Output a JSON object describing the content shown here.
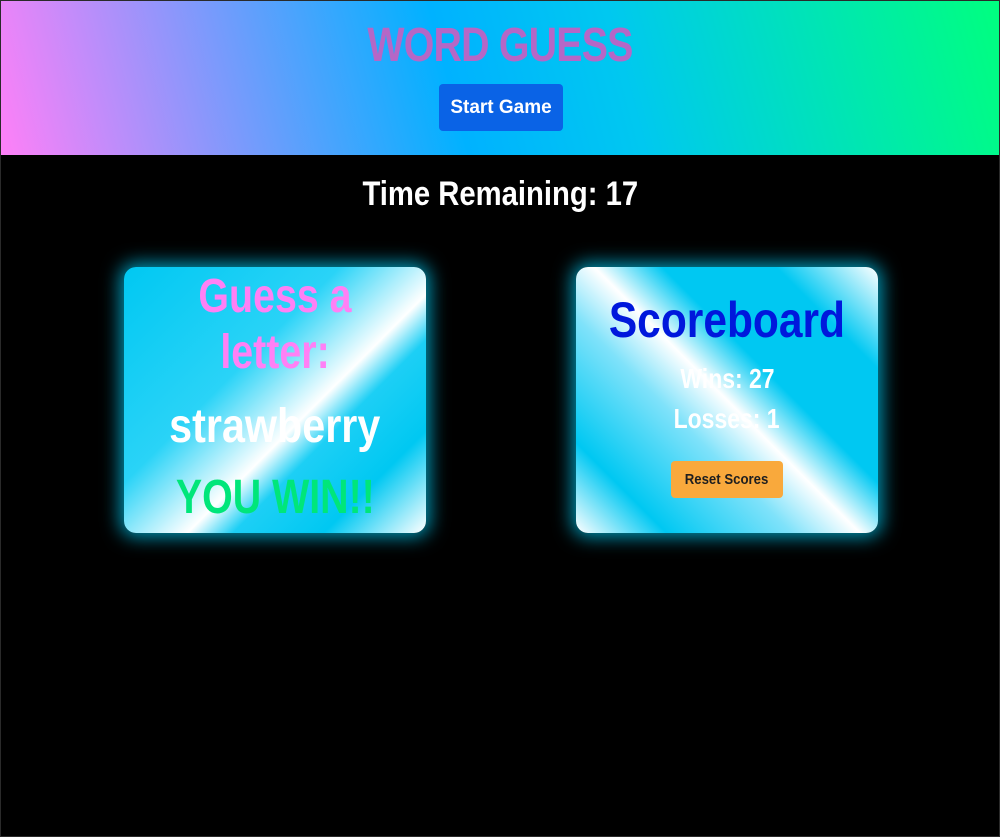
{
  "header": {
    "title": "WORD GUESS",
    "start_label": "Start Game"
  },
  "timer": {
    "text": "Time Remaining: 17",
    "seconds_remaining": 17
  },
  "game": {
    "prompt": "Guess a letter:",
    "word": "strawberry",
    "result": "YOU WIN!!"
  },
  "scoreboard": {
    "title": "Scoreboard",
    "wins_text": "Wins: 27",
    "losses_text": "Losses: 1",
    "wins": 27,
    "losses": 1,
    "reset_label": "Reset Scores"
  },
  "colors": {
    "background": "#000000",
    "title": "#b567c6",
    "start_button": "#0a63e6",
    "prompt": "#ff80f5",
    "result": "#00e67a",
    "scoreboard_title": "#0018dc",
    "reset_button": "#f9a93c",
    "card_glow": "#00c8f0"
  }
}
